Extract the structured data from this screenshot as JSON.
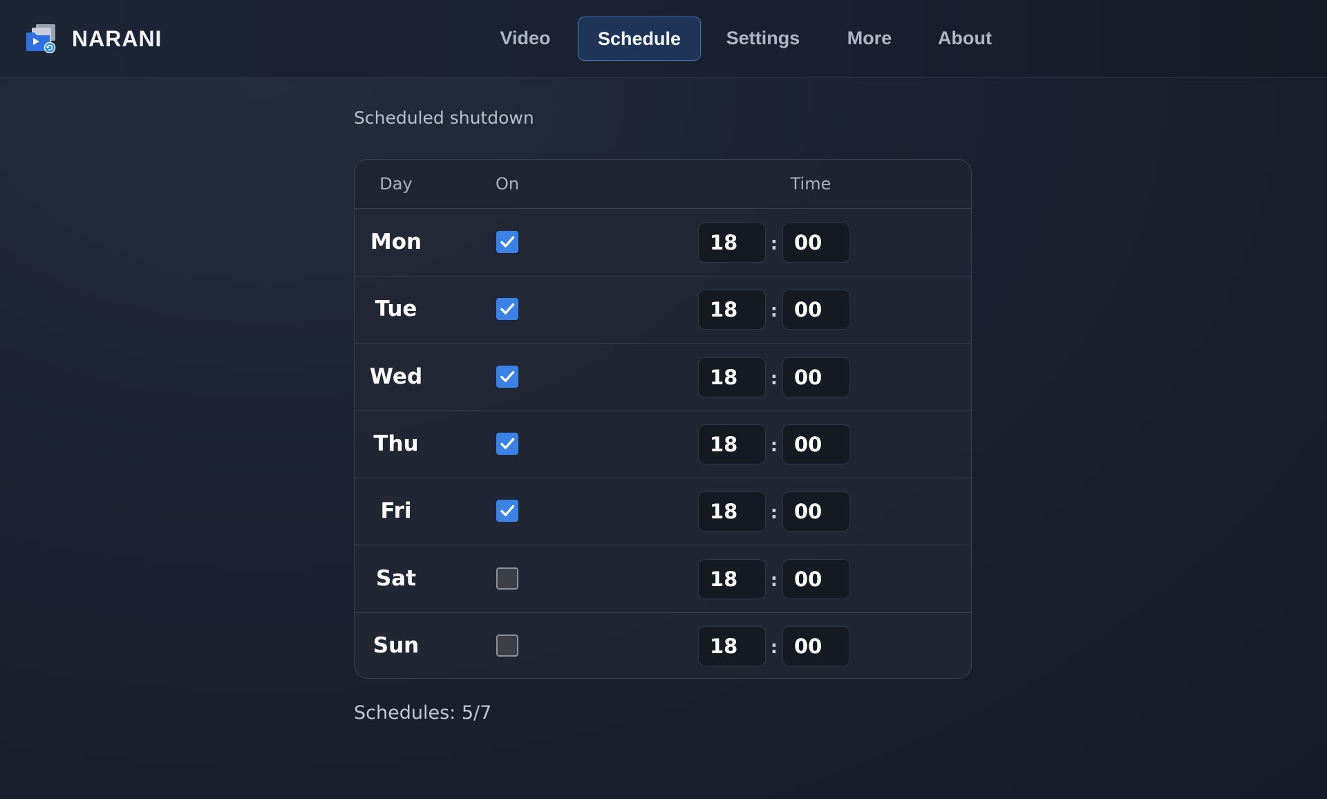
{
  "app": {
    "name": "NARANI",
    "logo_icon": "video-folder-icon"
  },
  "nav": {
    "items": [
      {
        "label": "Video",
        "active": false
      },
      {
        "label": "Schedule",
        "active": true
      },
      {
        "label": "Settings",
        "active": false
      },
      {
        "label": "More",
        "active": false
      },
      {
        "label": "About",
        "active": false
      }
    ]
  },
  "schedule": {
    "title": "Scheduled shutdown",
    "columns": {
      "day": "Day",
      "on": "On",
      "time": "Time"
    },
    "separator": ":",
    "rows": [
      {
        "day": "Mon",
        "on": true,
        "hour": "18",
        "minute": "00"
      },
      {
        "day": "Tue",
        "on": true,
        "hour": "18",
        "minute": "00"
      },
      {
        "day": "Wed",
        "on": true,
        "hour": "18",
        "minute": "00"
      },
      {
        "day": "Thu",
        "on": true,
        "hour": "18",
        "minute": "00"
      },
      {
        "day": "Fri",
        "on": true,
        "hour": "18",
        "minute": "00"
      },
      {
        "day": "Sat",
        "on": false,
        "hour": "18",
        "minute": "00"
      },
      {
        "day": "Sun",
        "on": false,
        "hour": "18",
        "minute": "00"
      }
    ],
    "summary": "Schedules: 5/7"
  },
  "colors": {
    "accent": "#3b82e6",
    "active_tab_bg": "#1f3456",
    "active_tab_border": "#3b6db3"
  }
}
